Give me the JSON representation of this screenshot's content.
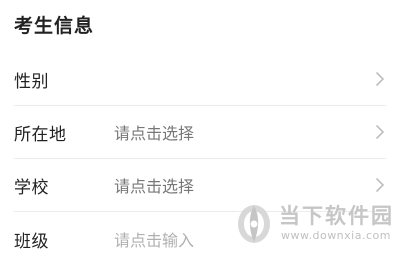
{
  "section": {
    "title": "考生信息"
  },
  "rows": [
    {
      "label": "性别",
      "value": "",
      "chevron": true
    },
    {
      "label": "所在地",
      "value": "请点击选择",
      "chevron": true
    },
    {
      "label": "学校",
      "value": "请点击选择",
      "chevron": true
    },
    {
      "label": "班级",
      "value": "",
      "placeholder": "请点击输入",
      "chevron": false
    }
  ],
  "watermark": {
    "name": "当下软件园",
    "url": "www.downxia.com"
  },
  "colors": {
    "text": "#222222",
    "value": "#777777",
    "placeholder": "#b0b0b0",
    "divider": "#ececec",
    "chevron": "#bdbdbd"
  }
}
